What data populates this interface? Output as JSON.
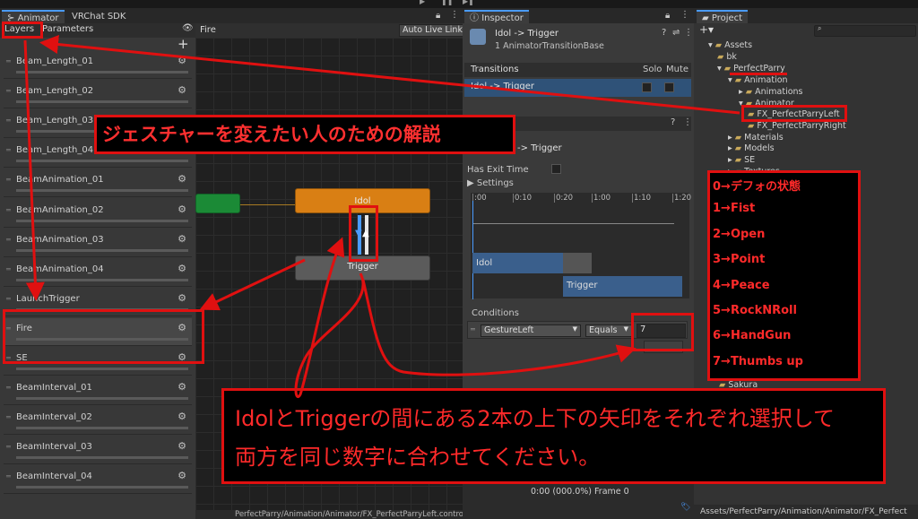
{
  "top_toolbar": {
    "play_icon": "play-icon",
    "pause_icon": "pause-icon",
    "step_icon": "step-icon"
  },
  "tabs": {
    "animator": "Animator",
    "vrchat": "VRChat SDK",
    "inspector": "Inspector",
    "project": "Project"
  },
  "animator": {
    "sub_tabs": {
      "layers": "Layers",
      "parameters": "Parameters"
    },
    "breadcrumb": "Fire",
    "auto_live_link": "Auto Live Link",
    "layers": [
      {
        "name": "Beam_Length_01"
      },
      {
        "name": "Beam_Length_02"
      },
      {
        "name": "Beam_Length_03"
      },
      {
        "name": "Beam_Length_04"
      },
      {
        "name": "BeamAnimation_01"
      },
      {
        "name": "BeamAnimation_02"
      },
      {
        "name": "BeamAnimation_03"
      },
      {
        "name": "BeamAnimation_04"
      },
      {
        "name": "LaunchTrigger"
      },
      {
        "name": "Fire"
      },
      {
        "name": "SE"
      },
      {
        "name": "BeamInterval_01"
      },
      {
        "name": "BeamInterval_02"
      },
      {
        "name": "BeamInterval_03"
      },
      {
        "name": "BeamInterval_04"
      }
    ],
    "nodes": {
      "idol": "Idol",
      "trigger": "Trigger"
    },
    "footer_path": "PerfectParry/Animation/Animator/FX_PerfectParryLeft.controller"
  },
  "inspector": {
    "title": "Idol -> Trigger",
    "subtitle": "1 AnimatorTransitionBase",
    "transitions_label": "Transitions",
    "solo": "Solo",
    "mute": "Mute",
    "transition_row": "Idol -> Trigger",
    "section_title": "-> Trigger",
    "has_exit_time": "Has Exit Time",
    "settings": "Settings",
    "timeline_ticks": [
      ":00",
      "0:10",
      "0:20",
      "1:00",
      "1:10",
      "1:20"
    ],
    "timeline_idol": "Idol",
    "timeline_trigger": "Trigger",
    "conditions_label": "Conditions",
    "condition": {
      "parameter": "GestureLeft",
      "operator": "Equals",
      "value": "7"
    },
    "footer": "0:00 (000.0%) Frame 0"
  },
  "project": {
    "search_placeholder": "",
    "tree": [
      {
        "label": "Assets"
      },
      {
        "label": "bk"
      },
      {
        "label": "PerfectParry"
      },
      {
        "label": "Animation"
      },
      {
        "label": "Animations"
      },
      {
        "label": "Animator"
      },
      {
        "label": "FX_PerfectParryLeft"
      },
      {
        "label": "FX_PerfectParryRight"
      },
      {
        "label": "Materials"
      },
      {
        "label": "Models"
      },
      {
        "label": "SE"
      },
      {
        "label": "Textures"
      },
      {
        "label": "Sakura"
      }
    ],
    "footer": "Assets/PerfectParry/Animation/Animator/FX_Perfect"
  },
  "annotations": {
    "heading": "ジェスチャーを変えたい人のための解説",
    "gestures": [
      "0→デフォの状態",
      "1→Fist",
      "2→Open",
      "3→Point",
      "4→Peace",
      "5→RockNRoll",
      "6→HandGun",
      "7→Thumbs up"
    ],
    "instruction_line1": "IdolとTriggerの間にある2本の上下の矢印をそれぞれ選択して",
    "instruction_line2": "両方を同じ数字に合わせてください。"
  },
  "colors": {
    "annotation_red": "#e01010",
    "idol_orange": "#d97f14",
    "trigger_gray": "#5b5b5b",
    "entry_green": "#1b8a36",
    "selection_blue": "#4a9bff"
  }
}
